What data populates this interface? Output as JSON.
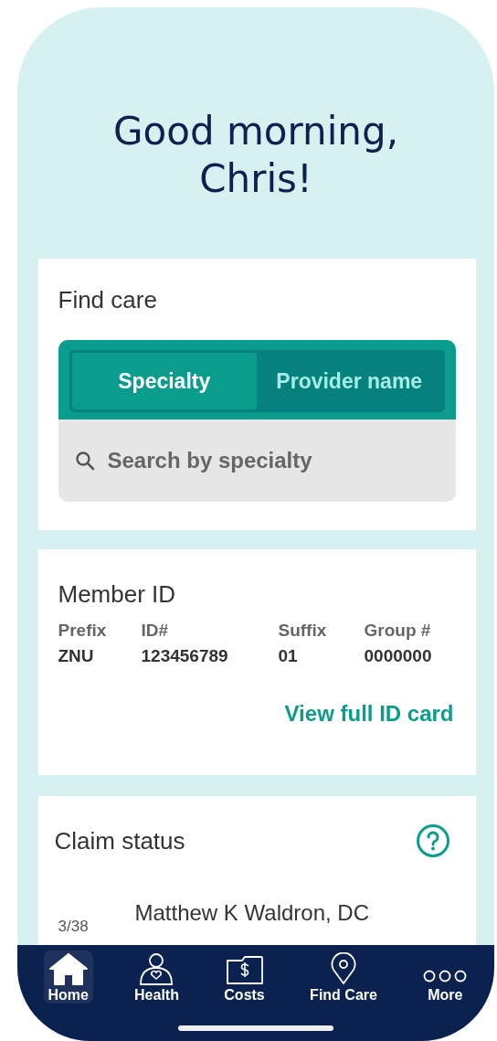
{
  "greeting": "Good morning, Chris!",
  "find_care": {
    "title": "Find care",
    "tabs": [
      {
        "label": "Specialty",
        "selected": true
      },
      {
        "label": "Provider name",
        "selected": false
      }
    ],
    "search": {
      "placeholder": "Search by specialty"
    }
  },
  "member_id": {
    "title": "Member ID",
    "fields": [
      {
        "label": "Prefix",
        "value": "ZNU"
      },
      {
        "label": "ID#",
        "value": "123456789"
      },
      {
        "label": "Suffix",
        "value": "01"
      },
      {
        "label": "Group #",
        "value": "0000000"
      }
    ],
    "link": "View full ID card"
  },
  "claim_status": {
    "title": "Claim status",
    "claims": [
      {
        "date": "3/38",
        "provider": "Matthew K Waldron, DC"
      }
    ]
  },
  "nav": [
    {
      "label": "Home",
      "selected": true
    },
    {
      "label": "Health",
      "selected": false
    },
    {
      "label": "Costs",
      "selected": false
    },
    {
      "label": "Find Care",
      "selected": false
    },
    {
      "label": "More",
      "selected": false
    }
  ]
}
